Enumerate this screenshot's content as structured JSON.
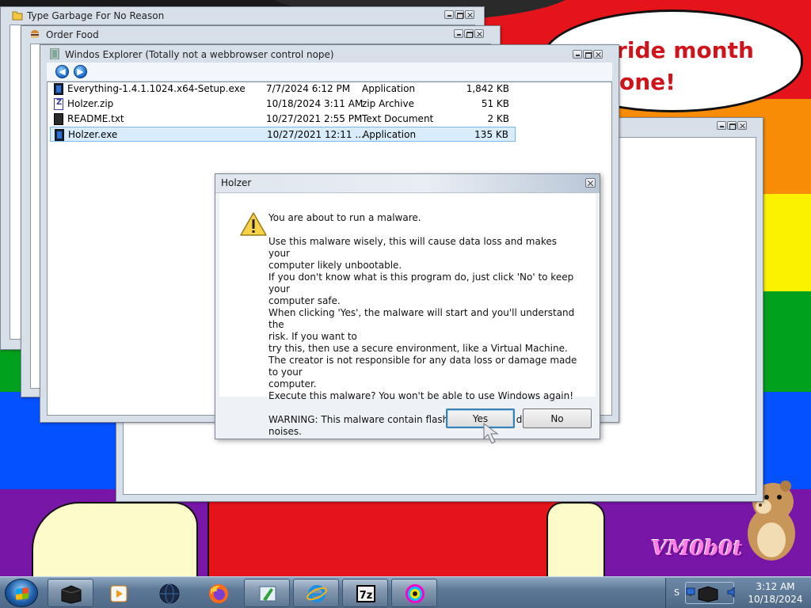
{
  "wallpaper": {
    "speech_line1": "y pride month",
    "speech_line2": "one!",
    "watermark": "VM0b0t",
    "stripe_colors": [
      "#e5141b",
      "#f98c06",
      "#fbf200",
      "#00a11d",
      "#0451ff",
      "#7816a8"
    ]
  },
  "windows": {
    "garbage": {
      "title": "Type Garbage For No Reason"
    },
    "food": {
      "title": "Order Food"
    },
    "explorer": {
      "title": "Windos Explorer (Totally not a webbrowser control nope)",
      "files": [
        {
          "name": "Everything-1.4.1.1024.x64-Setup.exe",
          "date": "7/7/2024 6:12 PM",
          "type": "Application",
          "size": "1,842 KB",
          "icon": "exe-icon",
          "selected": false
        },
        {
          "name": "Holzer.zip",
          "date": "10/18/2024 3:11 AM",
          "type": "zip Archive",
          "size": "51 KB",
          "icon": "zip-icon",
          "selected": false
        },
        {
          "name": "README.txt",
          "date": "10/27/2021 2:55 PM",
          "type": "Text Document",
          "size": "2 KB",
          "icon": "text-file-icon",
          "selected": false
        },
        {
          "name": "Holzer.exe",
          "date": "10/27/2021 12:11 ...",
          "type": "Application",
          "size": "135 KB",
          "icon": "exe-icon",
          "selected": true
        }
      ]
    }
  },
  "dialog": {
    "title": "Holzer",
    "icon": "warning-icon",
    "lines": [
      "You are about to run a malware.",
      "",
      "Use this malware wisely, this will cause data loss and makes your",
      "computer likely unbootable.",
      "If you don't know what is this program do, just click 'No' to keep your",
      "computer safe.",
      "When clicking 'Yes', the malware will start and you'll understand the",
      "risk. If you want to",
      "try this, then use a secure environment, like a Virtual Machine.",
      "The creator is not responsible for any data loss or damage made to your",
      "computer.",
      "Execute this malware? You won't be able to use Windows again!",
      "",
      "WARNING: This malware contain flashing lights and disturbing noises."
    ],
    "yes_label": "Yes",
    "no_label": "No"
  },
  "taskbar": {
    "items": [
      "terminal-icon",
      "media-player-icon",
      "globe-icon",
      "firefox-icon",
      "paint-icon",
      "internet-explorer-icon",
      "7zip-icon",
      "color-wheel-icon"
    ],
    "tray_label": "S",
    "time": "3:12 AM",
    "date": "10/18/2024"
  }
}
